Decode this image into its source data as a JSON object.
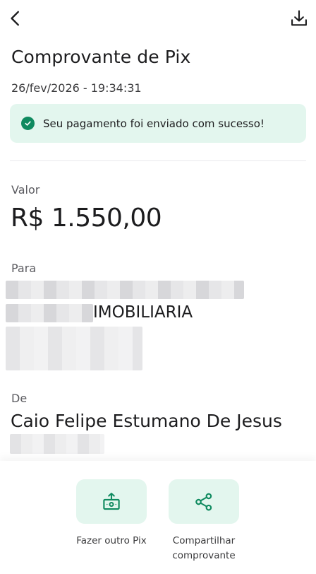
{
  "header": {
    "back_icon": "chevron-left-icon",
    "download_icon": "download-icon"
  },
  "receipt": {
    "title": "Comprovante de Pix",
    "datetime": "26/fev/2026 - 19:34:31",
    "success_message": "Seu pagamento foi enviado com sucesso!",
    "valor_label": "Valor",
    "amount": "R$ 1.550,00",
    "para_label": "Para",
    "para_name_visible": "IMOBILIARIA",
    "de_label": "De",
    "de_name": "Caio Felipe Estumano De Jesus"
  },
  "actions": [
    {
      "label": "Fazer outro Pix",
      "icon": "money-transfer-icon"
    },
    {
      "label": "Compartilhar comprovante",
      "icon": "share-icon"
    }
  ],
  "colors": {
    "accent": "#0f8a5f",
    "accent_light": "#e3f6ee"
  }
}
